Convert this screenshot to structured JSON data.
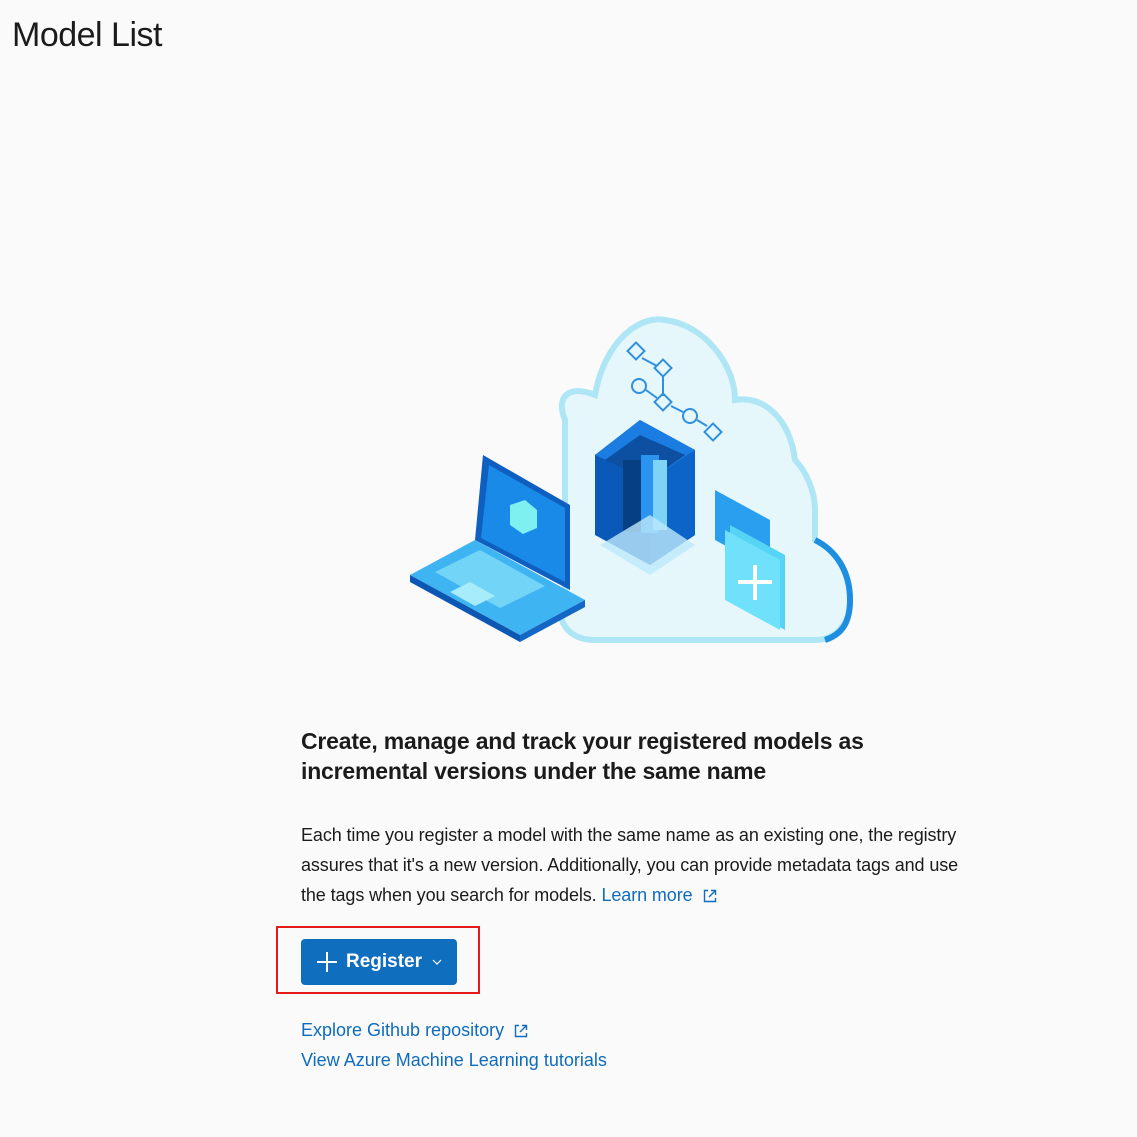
{
  "page": {
    "title": "Model List"
  },
  "empty_state": {
    "heading": "Create, manage and track your registered models as incremental versions under the same name",
    "body": "Each time you register a model with the same name as an existing one, the registry assures that it's a new version. Additionally, you can provide metadata tags and use the tags when you search for models.",
    "learn_more_label": "Learn more",
    "learn_more_icon": "external-link-icon",
    "illustration": "cloud-laptop-model-registry-illustration"
  },
  "actions": {
    "register_label": "Register",
    "register_icon": "plus-icon",
    "register_dropdown_icon": "chevron-down-icon"
  },
  "links": {
    "github_label": "Explore Github repository",
    "github_icon": "external-link-icon",
    "tutorials_label": "View Azure Machine Learning tutorials"
  },
  "colors": {
    "accent": "#106ebe",
    "link": "#0f6cbd",
    "highlight": "#e41b1b",
    "background": "#fafafa"
  }
}
